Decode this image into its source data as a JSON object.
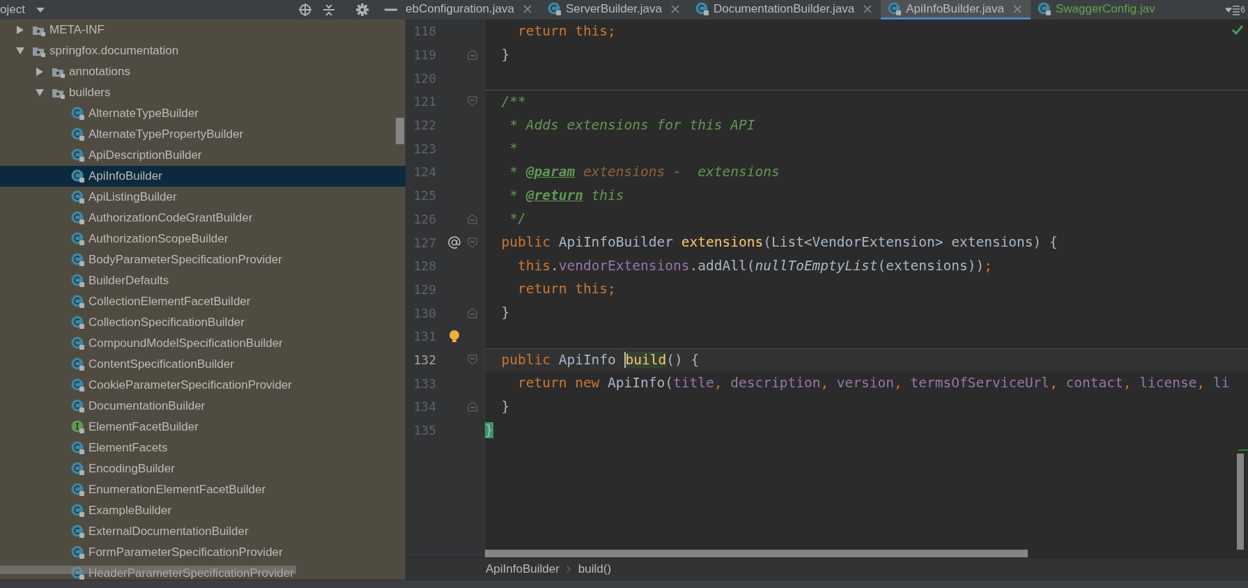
{
  "project_panel": {
    "title": "oject",
    "tree": [
      {
        "label": "META-INF",
        "kind": "folder",
        "expanded": false,
        "selected": false
      },
      {
        "label": "springfox.documentation",
        "kind": "folder",
        "expanded": true,
        "selected": false,
        "children": [
          {
            "label": "annotations",
            "kind": "folder",
            "expanded": false,
            "selected": false
          },
          {
            "label": "builders",
            "kind": "folder",
            "expanded": true,
            "selected": false,
            "children": [
              {
                "label": "AlternateTypeBuilder",
                "kind": "class",
                "selected": false
              },
              {
                "label": "AlternateTypePropertyBuilder",
                "kind": "class",
                "selected": false
              },
              {
                "label": "ApiDescriptionBuilder",
                "kind": "class",
                "selected": false
              },
              {
                "label": "ApiInfoBuilder",
                "kind": "class",
                "selected": true
              },
              {
                "label": "ApiListingBuilder",
                "kind": "class",
                "selected": false
              },
              {
                "label": "AuthorizationCodeGrantBuilder",
                "kind": "class",
                "selected": false
              },
              {
                "label": "AuthorizationScopeBuilder",
                "kind": "class",
                "selected": false
              },
              {
                "label": "BodyParameterSpecificationProvider",
                "kind": "class",
                "selected": false
              },
              {
                "label": "BuilderDefaults",
                "kind": "class",
                "selected": false
              },
              {
                "label": "CollectionElementFacetBuilder",
                "kind": "class",
                "selected": false
              },
              {
                "label": "CollectionSpecificationBuilder",
                "kind": "class",
                "selected": false
              },
              {
                "label": "CompoundModelSpecificationBuilder",
                "kind": "class",
                "selected": false
              },
              {
                "label": "ContentSpecificationBuilder",
                "kind": "class",
                "selected": false
              },
              {
                "label": "CookieParameterSpecificationProvider",
                "kind": "class",
                "selected": false
              },
              {
                "label": "DocumentationBuilder",
                "kind": "class",
                "selected": false
              },
              {
                "label": "ElementFacetBuilder",
                "kind": "interface",
                "selected": false
              },
              {
                "label": "ElementFacets",
                "kind": "class",
                "selected": false
              },
              {
                "label": "EncodingBuilder",
                "kind": "class",
                "selected": false
              },
              {
                "label": "EnumerationElementFacetBuilder",
                "kind": "class",
                "selected": false
              },
              {
                "label": "ExampleBuilder",
                "kind": "class",
                "selected": false
              },
              {
                "label": "ExternalDocumentationBuilder",
                "kind": "class",
                "selected": false
              },
              {
                "label": "FormParameterSpecificationProvider",
                "kind": "class",
                "selected": false
              },
              {
                "label": "HeaderParameterSpecificationProvider",
                "kind": "class",
                "selected": false
              }
            ]
          }
        ]
      }
    ]
  },
  "editor": {
    "tabs": [
      {
        "label": "ebConfiguration.java",
        "selected": false,
        "color": "#bbbbbb",
        "kind": "clipped"
      },
      {
        "label": "ServerBuilder.java",
        "selected": false,
        "color": "#bbbbbb",
        "kind": "class"
      },
      {
        "label": "DocumentationBuilder.java",
        "selected": false,
        "color": "#bbbbbb",
        "kind": "class"
      },
      {
        "label": "ApiInfoBuilder.java",
        "selected": true,
        "color": "#bbbbbb",
        "kind": "class"
      },
      {
        "label": "SwaggerConfig.jav",
        "selected": false,
        "color": "#62a34f",
        "kind": "class"
      }
    ],
    "tab_overflow_count": "6",
    "lines": [
      {
        "number": "118",
        "current": false,
        "separator": false,
        "tokens": [
          {
            "kind": "keyword",
            "text": "    return this;"
          }
        ]
      },
      {
        "number": "119",
        "current": false,
        "separator": false,
        "kind": "fold-end",
        "tokens": [
          {
            "kind": "plain",
            "text": "  }"
          }
        ]
      },
      {
        "number": "120",
        "current": false,
        "separator": false
      },
      {
        "number": "121",
        "current": false,
        "separator": true,
        "kind": "fold-start",
        "tokens": [
          {
            "kind": "comment",
            "text": "  /**"
          }
        ]
      },
      {
        "number": "122",
        "current": false,
        "separator": false,
        "tokens": [
          {
            "kind": "comment",
            "text": "   * Adds extensions for this API"
          }
        ]
      },
      {
        "number": "123",
        "current": false,
        "separator": false,
        "tokens": [
          {
            "kind": "comment",
            "text": "   *"
          }
        ]
      },
      {
        "number": "124",
        "current": false,
        "separator": false,
        "tokens": [
          {
            "kind": "comment",
            "text": "   * "
          },
          {
            "kind": "doctag",
            "text": "@param"
          },
          {
            "kind": "docparam",
            "text": " extensions"
          },
          {
            "kind": "comment",
            "text": " -  extensions"
          }
        ]
      },
      {
        "number": "125",
        "current": false,
        "separator": false,
        "tokens": [
          {
            "kind": "comment",
            "text": "   * "
          },
          {
            "kind": "doctag",
            "text": "@return"
          },
          {
            "kind": "comment",
            "text": " this"
          }
        ]
      },
      {
        "number": "126",
        "current": false,
        "separator": false,
        "kind": "fold-end",
        "tokens": [
          {
            "kind": "comment",
            "text": "   */"
          }
        ]
      },
      {
        "number": "127",
        "current": false,
        "separator": false,
        "kind": "override-start",
        "tokens": [
          {
            "kind": "keyword",
            "text": "  public"
          },
          {
            "kind": "plain",
            "text": " ApiInfoBuilder "
          },
          {
            "kind": "method",
            "text": "extensions"
          },
          {
            "kind": "plain",
            "text": "(List<VendorExtension> extensions) {"
          }
        ]
      },
      {
        "number": "128",
        "current": false,
        "separator": false,
        "tokens": [
          {
            "kind": "keyword",
            "text": "    this"
          },
          {
            "kind": "plain",
            "text": "."
          },
          {
            "kind": "field",
            "text": "vendorExtensions"
          },
          {
            "kind": "plain",
            "text": ".addAll("
          },
          {
            "kind": "static",
            "text": "nullToEmptyList"
          },
          {
            "kind": "plain",
            "text": "(extensions))"
          },
          {
            "kind": "keyword",
            "text": ";"
          }
        ]
      },
      {
        "number": "129",
        "current": false,
        "separator": false,
        "tokens": [
          {
            "kind": "keyword",
            "text": "    return this;"
          }
        ]
      },
      {
        "number": "130",
        "current": false,
        "separator": false,
        "kind": "fold-end",
        "tokens": [
          {
            "kind": "plain",
            "text": "  }"
          }
        ]
      },
      {
        "number": "131",
        "current": false,
        "separator": false,
        "kind": "bulb"
      },
      {
        "number": "132",
        "current": true,
        "separator": true,
        "kind": "fold-start",
        "tokens": [
          {
            "kind": "keyword",
            "text": "  public"
          },
          {
            "kind": "plain",
            "text": " ApiInfo "
          },
          {
            "kind": "caret-method",
            "text": "build"
          },
          {
            "kind": "plain",
            "text": "() {"
          }
        ]
      },
      {
        "number": "133",
        "current": false,
        "separator": false,
        "tokens": [
          {
            "kind": "keyword",
            "text": "    return new"
          },
          {
            "kind": "plain",
            "text": " ApiInfo("
          },
          {
            "kind": "field",
            "text": "title"
          },
          {
            "kind": "keyword",
            "text": ", "
          },
          {
            "kind": "field",
            "text": "description"
          },
          {
            "kind": "keyword",
            "text": ", "
          },
          {
            "kind": "field",
            "text": "version"
          },
          {
            "kind": "keyword",
            "text": ", "
          },
          {
            "kind": "field",
            "text": "termsOfServiceUrl"
          },
          {
            "kind": "keyword",
            "text": ", "
          },
          {
            "kind": "field",
            "text": "contact"
          },
          {
            "kind": "keyword",
            "text": ", "
          },
          {
            "kind": "field",
            "text": "license"
          },
          {
            "kind": "keyword",
            "text": ", "
          },
          {
            "kind": "field",
            "text": "li"
          }
        ]
      },
      {
        "number": "134",
        "current": false,
        "separator": false,
        "kind": "fold-end",
        "tokens": [
          {
            "kind": "plain",
            "text": "  }"
          }
        ]
      },
      {
        "number": "135",
        "current": false,
        "separator": false,
        "tokens": [
          {
            "kind": "matched-brace",
            "text": "}"
          }
        ]
      }
    ],
    "breadcrumbs": [
      "ApiInfoBuilder",
      "build()"
    ]
  }
}
